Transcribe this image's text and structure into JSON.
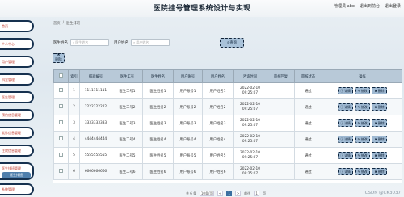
{
  "header": {
    "title": "医院挂号管理系统设计与实现",
    "user": "管理员 abo",
    "back": "退出到前台",
    "logout": "退出登录"
  },
  "sidebar": {
    "items": [
      {
        "label": "首页"
      },
      {
        "label": "个人中心"
      },
      {
        "label": "用户管理"
      },
      {
        "label": "科室管理"
      },
      {
        "label": "医生管理"
      },
      {
        "label": "预约信息管理"
      },
      {
        "label": "就诊信息管理"
      },
      {
        "label": "住院信息管理"
      },
      {
        "label": "医生排班管理"
      },
      {
        "label": "系统管理"
      }
    ],
    "active_sub": "医生排班"
  },
  "breadcrumb": {
    "home": "首页",
    "sep": "/",
    "current": "医生排班"
  },
  "search": {
    "label1": "医生姓名",
    "placeholder1": "医生姓名",
    "label2": "用户姓名",
    "placeholder2": "用户姓名",
    "find_label": "查询",
    "delete_label": "删除"
  },
  "table": {
    "headers": [
      "",
      "索引",
      "排班编号",
      "医生工号",
      "医生姓名",
      "用户账号",
      "用户姓名",
      "咨询时间",
      "审核回复",
      "审核状态",
      "操作"
    ],
    "rows": [
      {
        "index": "1",
        "code": "1111111111",
        "doc_no": "医生工号1",
        "doc_name": "医生姓名1",
        "acct": "用户账号1",
        "uname": "用户姓名1",
        "time": "2022-02-10 09:25:07",
        "reply": "",
        "status": "通过"
      },
      {
        "index": "2",
        "code": "2222222222",
        "doc_no": "医生工号2",
        "doc_name": "医生姓名2",
        "acct": "用户账号2",
        "uname": "用户姓名2",
        "time": "2022-02-10 09:25:07",
        "reply": "",
        "status": "通过"
      },
      {
        "index": "3",
        "code": "3333333333",
        "doc_no": "医生工号3",
        "doc_name": "医生姓名3",
        "acct": "用户账号3",
        "uname": "用户姓名3",
        "time": "2022-02-10 09:25:07",
        "reply": "",
        "status": "通过"
      },
      {
        "index": "4",
        "code": "4444444444",
        "doc_no": "医生工号4",
        "doc_name": "医生姓名4",
        "acct": "用户账号4",
        "uname": "用户姓名4",
        "time": "2022-02-10 09:25:07",
        "reply": "",
        "status": "通过"
      },
      {
        "index": "5",
        "code": "5555555555",
        "doc_no": "医生工号5",
        "doc_name": "医生姓名5",
        "acct": "用户账号5",
        "uname": "用户姓名5",
        "time": "2022-02-10 09:25:07",
        "reply": "",
        "status": "通过"
      },
      {
        "index": "6",
        "code": "6666666666",
        "doc_no": "医生工号6",
        "doc_name": "医生姓名6",
        "acct": "用户账号6",
        "uname": "用户姓名6",
        "time": "2022-02-10 09:25:07",
        "reply": "",
        "status": "通过"
      }
    ],
    "op_labels": {
      "detail": "详情",
      "edit": "修改",
      "delete": "删除"
    }
  },
  "pager": {
    "total": "共 6 条",
    "size": "10条/页",
    "prev": "<",
    "page": "1",
    "next": ">",
    "goto": "前往",
    "pageno": "1",
    "unit": "页"
  },
  "watermark": "CSDN @CK3037"
}
